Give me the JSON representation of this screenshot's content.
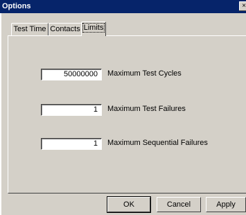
{
  "window": {
    "title": "Options",
    "close_glyph": "×"
  },
  "tabs": [
    {
      "label": "Test Time",
      "active": false
    },
    {
      "label": "Contacts",
      "active": false
    },
    {
      "label": "Limits",
      "active": true
    }
  ],
  "limits": {
    "max_test_cycles": {
      "value": "50000000",
      "label": "Maximum Test Cycles"
    },
    "max_test_failures": {
      "value": "1",
      "label": "Maximum Test Failures"
    },
    "max_sequential_failures": {
      "value": "1",
      "label": "Maximum Sequential Failures"
    }
  },
  "buttons": {
    "ok": "OK",
    "cancel": "Cancel",
    "apply": "Apply"
  }
}
